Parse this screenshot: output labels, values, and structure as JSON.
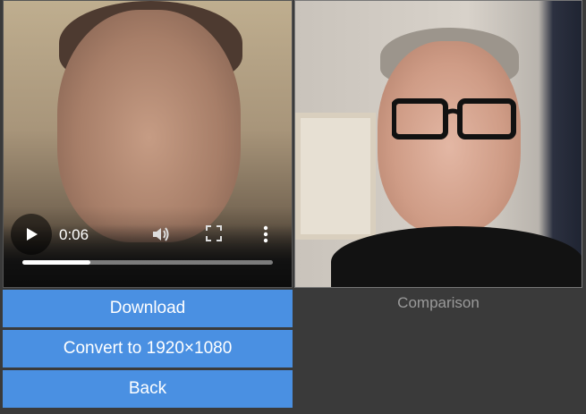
{
  "video": {
    "time": "0:06",
    "progress_fraction": 0.27,
    "icons": {
      "play": "play-icon",
      "volume": "volume-icon",
      "fullscreen": "fullscreen-icon",
      "menu": "more-vert-icon"
    }
  },
  "buttons": {
    "download": "Download",
    "convert": "Convert to 1920×1080",
    "back": "Back"
  },
  "comparison": {
    "caption": "Comparison"
  },
  "colors": {
    "accent": "#4a90e2",
    "background": "#3a3a3a"
  }
}
